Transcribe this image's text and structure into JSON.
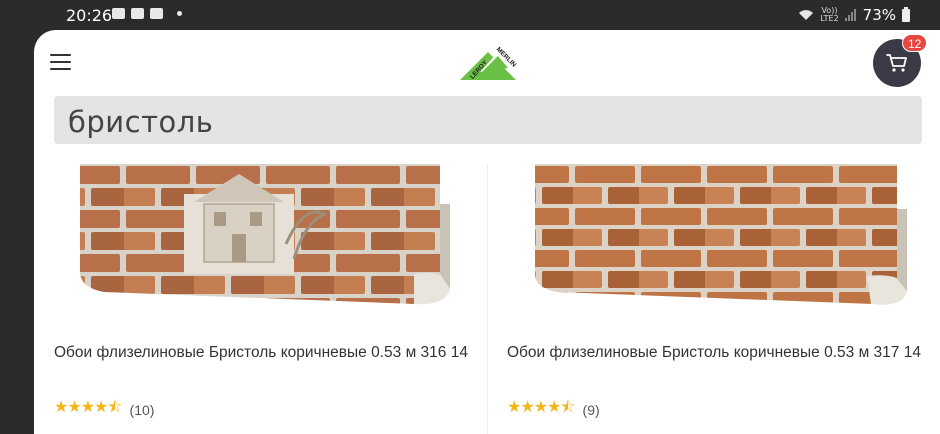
{
  "status_bar": {
    "time": "20:26",
    "battery": "73%",
    "network_label": "Vo))\nLTE2"
  },
  "header": {
    "logo_text": "LEROY MERLIN",
    "cart_count": "12"
  },
  "search": {
    "query": "бристоль"
  },
  "products": [
    {
      "title": "Обои флизелиновые Бристоль коричневые 0.53 м 316 14",
      "rating": 4.5,
      "reviews": "(10)"
    },
    {
      "title": "Обои флизелиновые Бристоль коричневые 0.53 м 317 14",
      "rating": 4.5,
      "reviews": "(9)"
    }
  ],
  "colors": {
    "brand_green": "#6ac044",
    "cart_button": "#3b3b48",
    "badge": "#e8473f",
    "star": "#f2b619"
  }
}
